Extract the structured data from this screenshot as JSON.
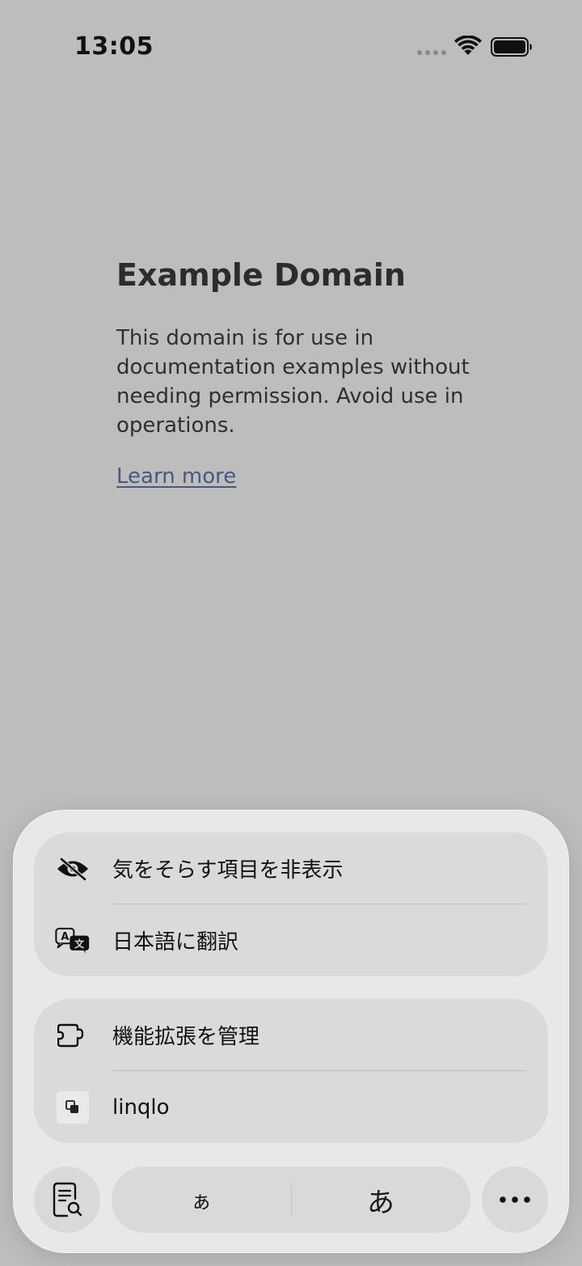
{
  "status_bar": {
    "time": "13:05"
  },
  "page": {
    "heading": "Example Domain",
    "body": "This domain is for use in documentation examples without needing permission. Avoid use in operations.",
    "link": "Learn more"
  },
  "menu": {
    "group1": [
      {
        "label": "気をそらす項目を非表示",
        "icon": "eye-slash-icon"
      },
      {
        "label": "日本語に翻訳",
        "icon": "translate-icon"
      }
    ],
    "group2": [
      {
        "label": "機能拡張を管理",
        "icon": "puzzle-icon"
      },
      {
        "label": "linqlo",
        "icon": "linqlo-extension-icon"
      }
    ]
  },
  "bottom_bar": {
    "smaller_text": "ぁ",
    "larger_text": "あ",
    "reader_icon": "reader-search-icon",
    "more_icon": "ellipsis-icon"
  },
  "colors": {
    "page_bg": "#bdbdbd",
    "sheet_bg": "#e8e8e8",
    "group_bg": "#dadada",
    "link": "#4b5780"
  }
}
